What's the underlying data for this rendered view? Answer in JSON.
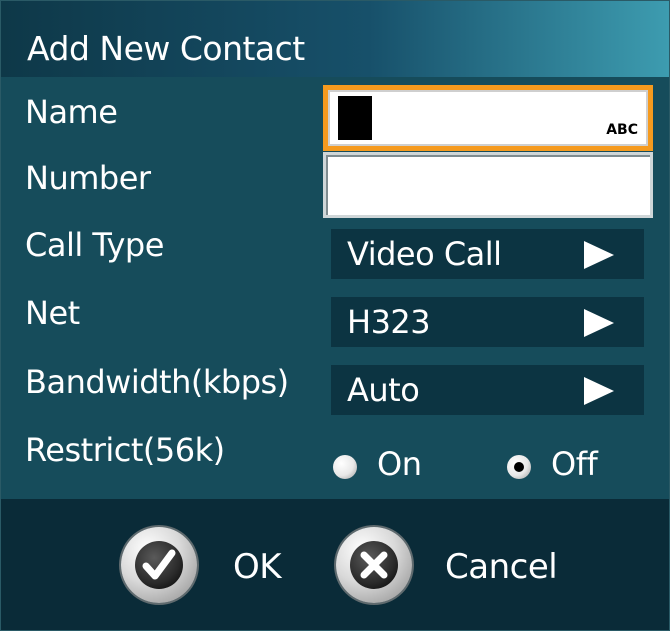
{
  "dialog": {
    "title": "Add New Contact"
  },
  "fields": {
    "name": {
      "label": "Name",
      "value": "",
      "mode": "ABC"
    },
    "number": {
      "label": "Number",
      "value": ""
    },
    "call_type": {
      "label": "Call Type",
      "value": "Video Call"
    },
    "net": {
      "label": "Net",
      "value": "H323"
    },
    "bandwidth": {
      "label": "Bandwidth(kbps)",
      "value": "Auto"
    },
    "restrict": {
      "label": "Restrict(56k)",
      "options": [
        "On",
        "Off"
      ],
      "selected": "Off"
    }
  },
  "buttons": {
    "ok_label": "OK",
    "cancel_label": "Cancel"
  },
  "icons": {
    "ok": "check-icon",
    "cancel": "x-icon",
    "selector_arrow": "play-right-icon"
  },
  "colors": {
    "background": "#164c5b",
    "footer": "#0a2b38",
    "selector": "#0c3442",
    "focus_border": "#f59a1e"
  }
}
